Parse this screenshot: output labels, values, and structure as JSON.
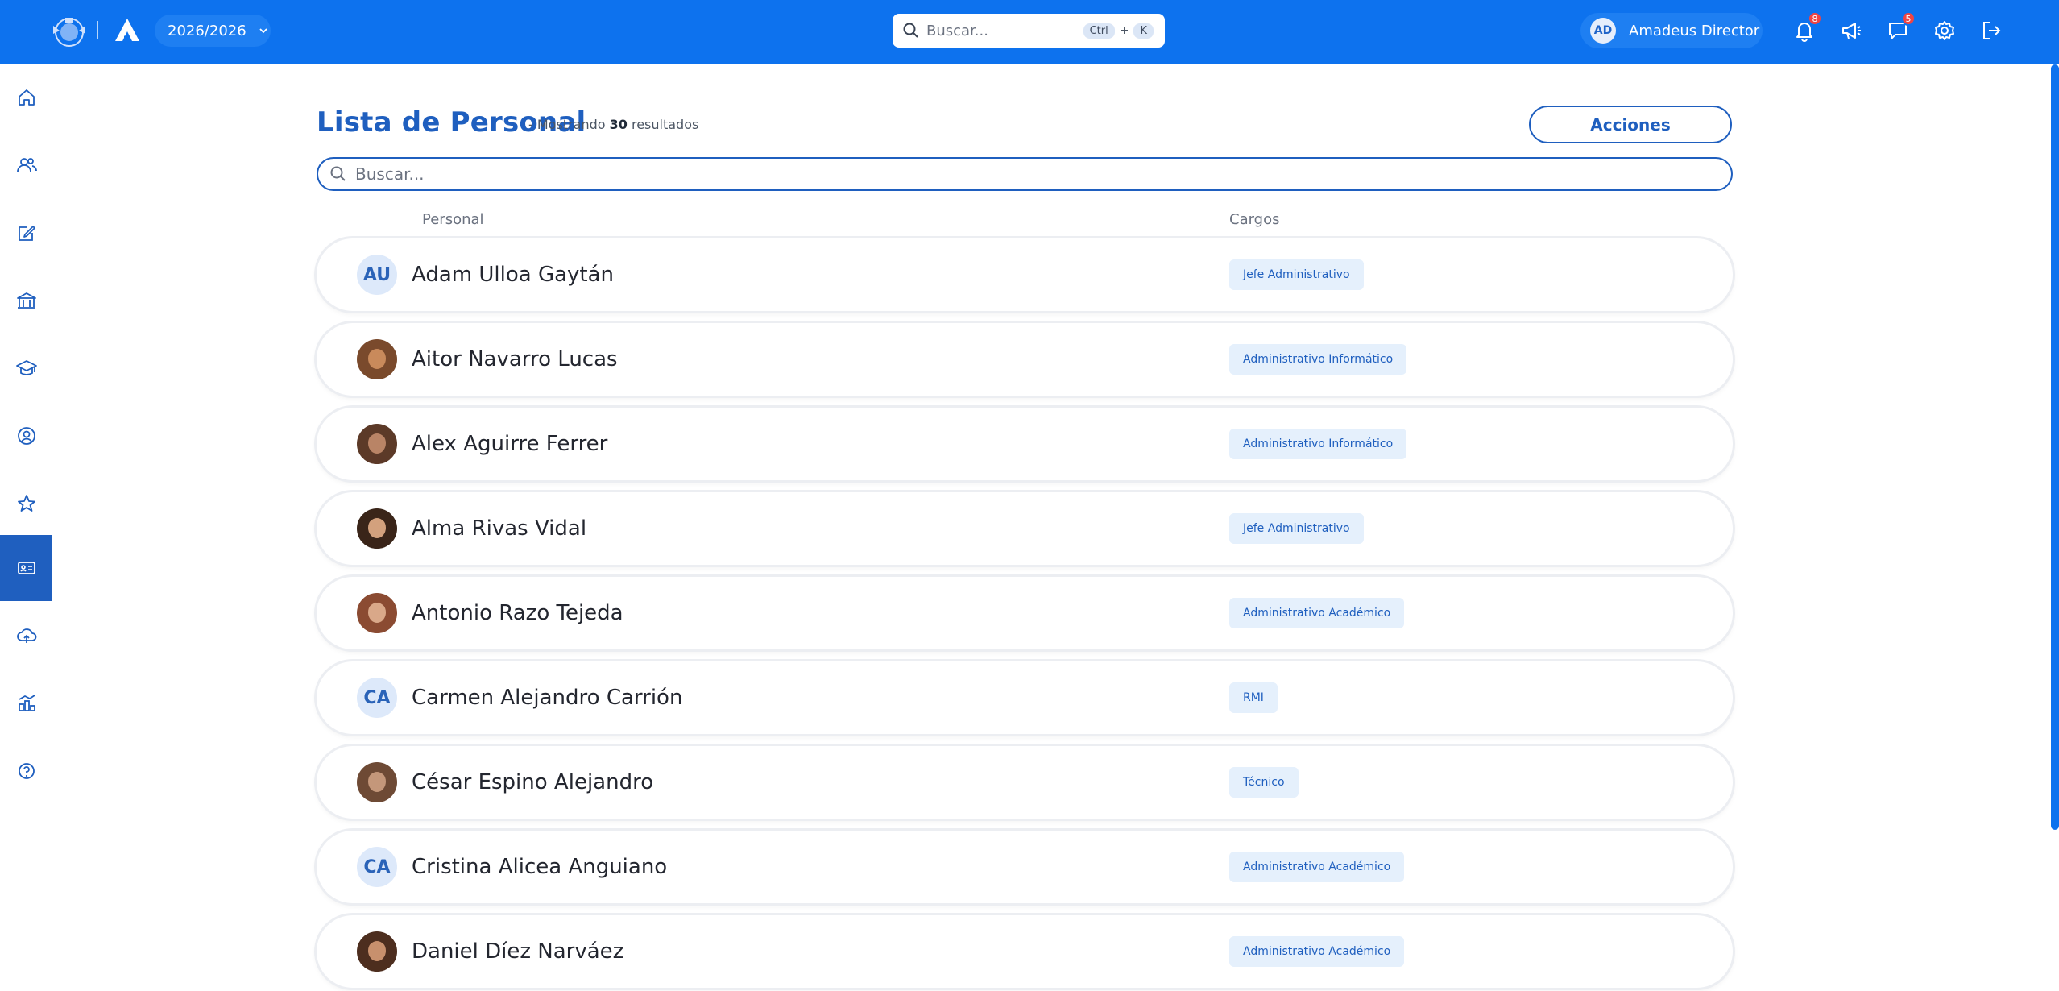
{
  "header": {
    "year": "2026/2026",
    "search_placeholder": "Buscar...",
    "shortcut": {
      "key1": "Ctrl",
      "plus": "+",
      "key2": "K"
    },
    "user": {
      "initials": "AD",
      "name": "Amadeus Director"
    },
    "notifications_count": "8",
    "messages_count": "5"
  },
  "sidebar": {
    "items": [
      {
        "icon": "home-icon"
      },
      {
        "icon": "users-icon"
      },
      {
        "icon": "edit-icon"
      },
      {
        "icon": "school-icon"
      },
      {
        "icon": "graduation-cap-icon"
      },
      {
        "icon": "user-circle-icon"
      },
      {
        "icon": "star-icon"
      },
      {
        "icon": "id-card-icon",
        "active": true
      },
      {
        "icon": "cloud-upload-icon"
      },
      {
        "icon": "chart-icon"
      },
      {
        "icon": "help-icon"
      }
    ]
  },
  "main": {
    "title": "Lista de Personal",
    "subtitle_prefix": "- Mostrando ",
    "count": "30",
    "subtitle_suffix": " resultados",
    "actions_label": "Acciones",
    "search_placeholder": "Buscar...",
    "col_personal": "Personal",
    "col_cargos": "Cargos",
    "rows": [
      {
        "initials": "AU",
        "photo": false,
        "name": "Adam Ulloa Gaytán",
        "cargo": "Jefe Administrativo"
      },
      {
        "initials": "",
        "photo": true,
        "name": "Aitor Navarro Lucas",
        "cargo": "Administrativo Informático"
      },
      {
        "initials": "",
        "photo": true,
        "name": "Alex Aguirre Ferrer",
        "cargo": "Administrativo Informático"
      },
      {
        "initials": "",
        "photo": true,
        "name": "Alma Rivas Vidal",
        "cargo": "Jefe Administrativo"
      },
      {
        "initials": "",
        "photo": true,
        "name": "Antonio Razo Tejeda",
        "cargo": "Administrativo Académico"
      },
      {
        "initials": "CA",
        "photo": false,
        "name": "Carmen Alejandro Carrión",
        "cargo": "RMI"
      },
      {
        "initials": "",
        "photo": true,
        "name": "César Espino Alejandro",
        "cargo": "Técnico"
      },
      {
        "initials": "CA",
        "photo": false,
        "name": "Cristina Alicea Anguiano",
        "cargo": "Administrativo Académico"
      },
      {
        "initials": "",
        "photo": true,
        "name": "Daniel Díez Narváez",
        "cargo": "Administrativo Académico"
      }
    ]
  },
  "colors": {
    "topbar": "#0d72ee",
    "accent": "#1f5fbf",
    "chip_bg": "#e5f0fc"
  }
}
